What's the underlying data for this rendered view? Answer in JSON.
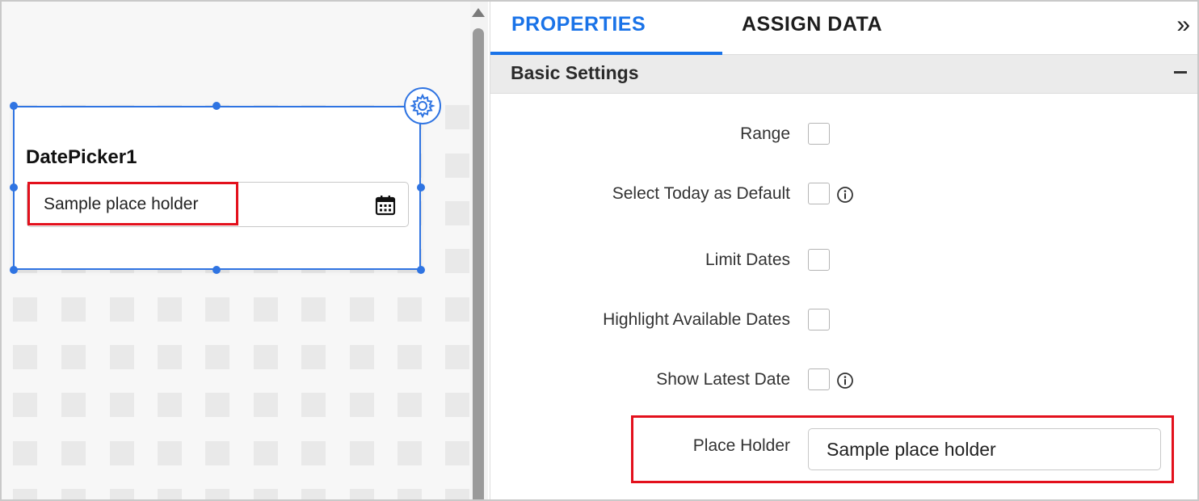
{
  "canvas": {
    "widget": {
      "title": "DatePicker1",
      "input_placeholder": "Sample place holder",
      "settings_icon": "gear-icon",
      "calendar_icon": "calendar-icon"
    }
  },
  "panel": {
    "tabs": [
      {
        "label": "PROPERTIES",
        "active": true
      },
      {
        "label": "ASSIGN DATA",
        "active": false
      }
    ],
    "collapse_label": "»",
    "section": {
      "title": "Basic Settings",
      "toggle_icon": "minus-icon"
    },
    "properties": [
      {
        "label": "Range",
        "checked": false,
        "info": false
      },
      {
        "label": "Select Today as Default",
        "checked": false,
        "info": true
      },
      {
        "label": "Limit Dates",
        "checked": false,
        "info": false
      },
      {
        "label": "Highlight Available Dates",
        "checked": false,
        "info": false
      },
      {
        "label": "Show Latest Date",
        "checked": false,
        "info": true
      }
    ],
    "placeholder_field": {
      "label": "Place Holder",
      "value": "Sample place holder"
    }
  },
  "colors": {
    "accent": "#1a73e8",
    "selection": "#2f74e2",
    "highlight": "#e3101c"
  }
}
